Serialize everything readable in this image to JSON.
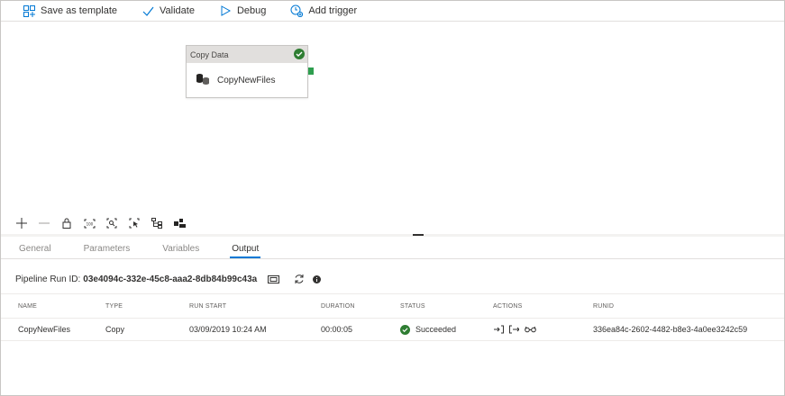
{
  "toolbar": {
    "save_template": "Save as template",
    "validate": "Validate",
    "debug": "Debug",
    "add_trigger": "Add trigger"
  },
  "activity": {
    "type_label": "Copy Data",
    "name": "CopyNewFiles",
    "status_icon": "check-circle-icon"
  },
  "tabs": [
    {
      "label": "General"
    },
    {
      "label": "Parameters"
    },
    {
      "label": "Variables"
    },
    {
      "label": "Output"
    }
  ],
  "active_tab": "Output",
  "pipeline": {
    "run_id_label": "Pipeline Run ID:",
    "run_id_value": "03e4094c-332e-45c8-aaa2-8db84b99c43a"
  },
  "table": {
    "headers": [
      "NAME",
      "TYPE",
      "RUN START",
      "DURATION",
      "STATUS",
      "ACTIONS",
      "RUNID"
    ],
    "rows": [
      {
        "name": "CopyNewFiles",
        "type": "Copy",
        "run_start": "03/09/2019 10:24 AM",
        "duration": "00:00:05",
        "status": "Succeeded",
        "runid": "336ea84c-2602-4482-b8e3-4a0ee3242c59"
      }
    ]
  },
  "colors": {
    "accent": "#0078d4",
    "success": "#2e7d32",
    "port": "#2e9e4f"
  }
}
